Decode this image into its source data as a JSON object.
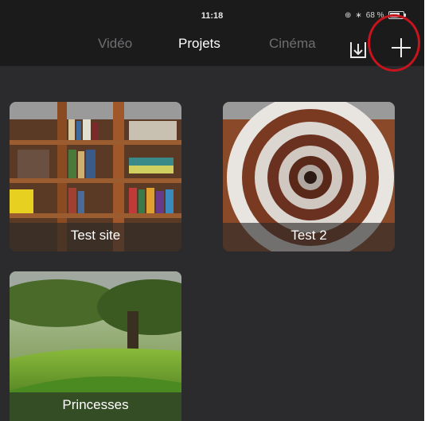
{
  "status_bar": {
    "time": "11:18",
    "battery": "68 %"
  },
  "nav": {
    "tabs": [
      {
        "label": "Vidéo",
        "active": false
      },
      {
        "label": "Projets",
        "active": true
      },
      {
        "label": "Cinéma",
        "active": false
      }
    ],
    "import_icon": "import-tray-icon",
    "add_icon": "plus-icon"
  },
  "projects": [
    {
      "title": "Test site"
    },
    {
      "title": "Test 2"
    },
    {
      "title": "Princesses"
    }
  ],
  "colors": {
    "background": "#2b2b2d",
    "topbar": "#1b1b1c",
    "highlight": "#c8141c",
    "inactive_tab": "#6f6f72"
  }
}
